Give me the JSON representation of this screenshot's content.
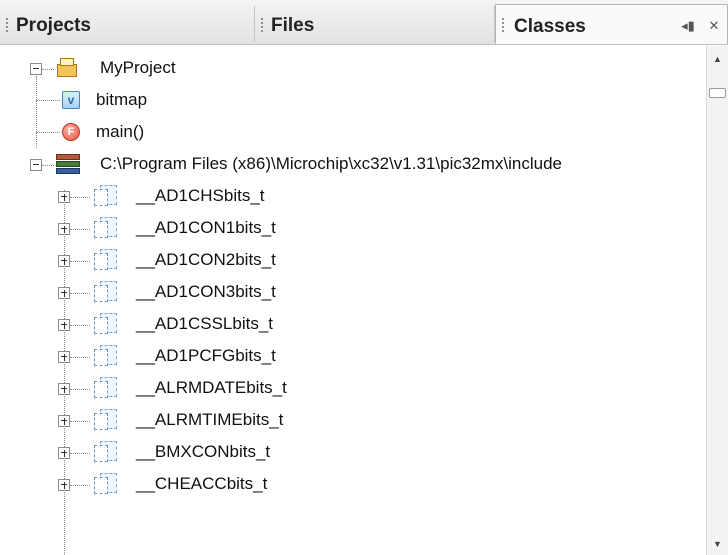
{
  "tabs": [
    {
      "label": "Projects"
    },
    {
      "label": "Files"
    },
    {
      "label": "Classes"
    }
  ],
  "tab_controls": {
    "minimize_icon": "minimize-icon",
    "close_icon": "close-icon"
  },
  "tree": {
    "project": {
      "label": "MyProject"
    },
    "project_children": [
      {
        "label": "bitmap",
        "icon": "variable-icon",
        "glyph": "v"
      },
      {
        "label": "main()",
        "icon": "function-icon",
        "glyph": "F"
      }
    ],
    "library": {
      "label": "C:\\Program Files (x86)\\Microchip\\xc32\\v1.31\\pic32mx\\include"
    },
    "classes": [
      {
        "label": "__AD1CHSbits_t"
      },
      {
        "label": "__AD1CON1bits_t"
      },
      {
        "label": "__AD1CON2bits_t"
      },
      {
        "label": "__AD1CON3bits_t"
      },
      {
        "label": "__AD1CSSLbits_t"
      },
      {
        "label": "__AD1PCFGbits_t"
      },
      {
        "label": "__ALRMDATEbits_t"
      },
      {
        "label": "__ALRMTIMEbits_t"
      },
      {
        "label": "__BMXCONbits_t"
      },
      {
        "label": "__CHEACCbits_t"
      }
    ]
  },
  "scrollbar": {
    "up_arrow": "▲",
    "down_arrow": "▼"
  }
}
